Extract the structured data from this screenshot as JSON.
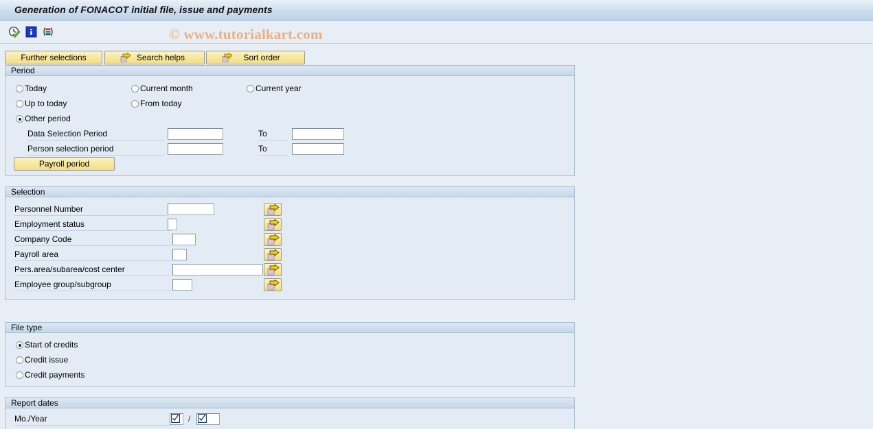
{
  "window": {
    "title": "Generation of  FONACOT initial file, issue and payments",
    "watermark": "© www.tutorialkart.com"
  },
  "toolbar": {
    "icons": [
      {
        "name": "execute-clock-icon",
        "title": "Execute"
      },
      {
        "name": "information-icon",
        "title": "Information"
      },
      {
        "name": "multiple-selection-icon",
        "title": "Multiple selection"
      }
    ]
  },
  "action_buttons": [
    {
      "name": "further-selections-button",
      "label": "Further selections",
      "icon": ""
    },
    {
      "name": "search-helps-button",
      "label": "Search helps",
      "icon": "arrow-right-icon"
    },
    {
      "name": "sort-order-button",
      "label": "Sort order",
      "icon": "arrow-right-icon"
    }
  ],
  "period": {
    "title": "Period",
    "radios": [
      {
        "label": "Today",
        "selected": false
      },
      {
        "label": "Current month",
        "selected": false
      },
      {
        "label": "Current year",
        "selected": false
      },
      {
        "label": "Up to today",
        "selected": false
      },
      {
        "label": "From today",
        "selected": false
      },
      {
        "label": "Other period",
        "selected": true
      }
    ],
    "fields": [
      {
        "label": "Data Selection Period",
        "value": "",
        "to_label": "To",
        "to_value": ""
      },
      {
        "label": "Person selection period",
        "value": "",
        "to_label": "To",
        "to_value": ""
      }
    ],
    "payroll_button": "Payroll period"
  },
  "selection": {
    "title": "Selection",
    "rows": [
      {
        "label": "Personnel Number",
        "value": ""
      },
      {
        "label": "Employment status",
        "value": ""
      },
      {
        "label": "Company Code",
        "value": ""
      },
      {
        "label": "Payroll area",
        "value": ""
      },
      {
        "label": "Pers.area/subarea/cost center",
        "value": ""
      },
      {
        "label": "Employee group/subgroup",
        "value": ""
      }
    ]
  },
  "file_type": {
    "title": "File type",
    "radios": [
      {
        "label": "Start of credits",
        "selected": true
      },
      {
        "label": "Credit issue",
        "selected": false
      },
      {
        "label": "Credit payments",
        "selected": false
      }
    ]
  },
  "report_dates": {
    "title": "Report dates",
    "month_year_label": "Mo./Year",
    "separator": "/",
    "month_value": "",
    "year_value": ""
  },
  "colors": {
    "background": "#e8eef6",
    "panel": "#e3ecf5",
    "title_bar": "#c6d9ec",
    "button_yellow": "#f6e79a",
    "watermark": "#e8b184",
    "border": "#a8bed4"
  }
}
